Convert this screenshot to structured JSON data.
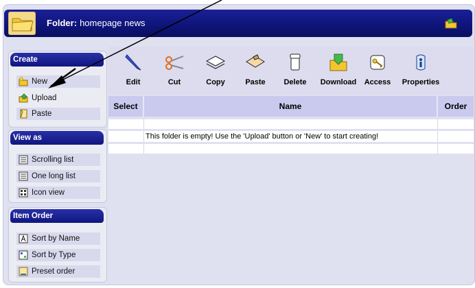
{
  "header": {
    "label": "Folder",
    "separator": ":",
    "folder_name": "homepage news"
  },
  "sidebar": {
    "create": {
      "title": "Create",
      "items": [
        {
          "label": "New",
          "icon": "new-folder-icon"
        },
        {
          "label": "Upload",
          "icon": "upload-icon"
        },
        {
          "label": "Paste",
          "icon": "paste-icon"
        }
      ]
    },
    "view_as": {
      "title": "View as",
      "items": [
        {
          "label": "Scrolling list",
          "icon": "list-icon"
        },
        {
          "label": "One long list",
          "icon": "list-icon"
        },
        {
          "label": "Icon view",
          "icon": "grid-icon"
        }
      ]
    },
    "item_order": {
      "title": "Item Order",
      "items": [
        {
          "label": "Sort by Name",
          "icon": "sort-name-icon"
        },
        {
          "label": "Sort by Type",
          "icon": "sort-type-icon"
        },
        {
          "label": "Preset order",
          "icon": "preset-order-icon"
        }
      ]
    }
  },
  "toolbar": {
    "edit": "Edit",
    "cut": "Cut",
    "copy": "Copy",
    "paste": "Paste",
    "delete": "Delete",
    "download": "Download",
    "access": "Access",
    "properties": "Properties"
  },
  "table": {
    "columns": [
      "Select",
      "Name",
      "Order"
    ],
    "empty_message": "This folder is empty! Use the 'Upload' button or 'New' to start creating!"
  },
  "colors": {
    "header_bg": "#0e1478",
    "panel_head_bg": "#10167e",
    "table_header_bg": "#c9caee",
    "frame_bg": "#dfe0f0"
  }
}
